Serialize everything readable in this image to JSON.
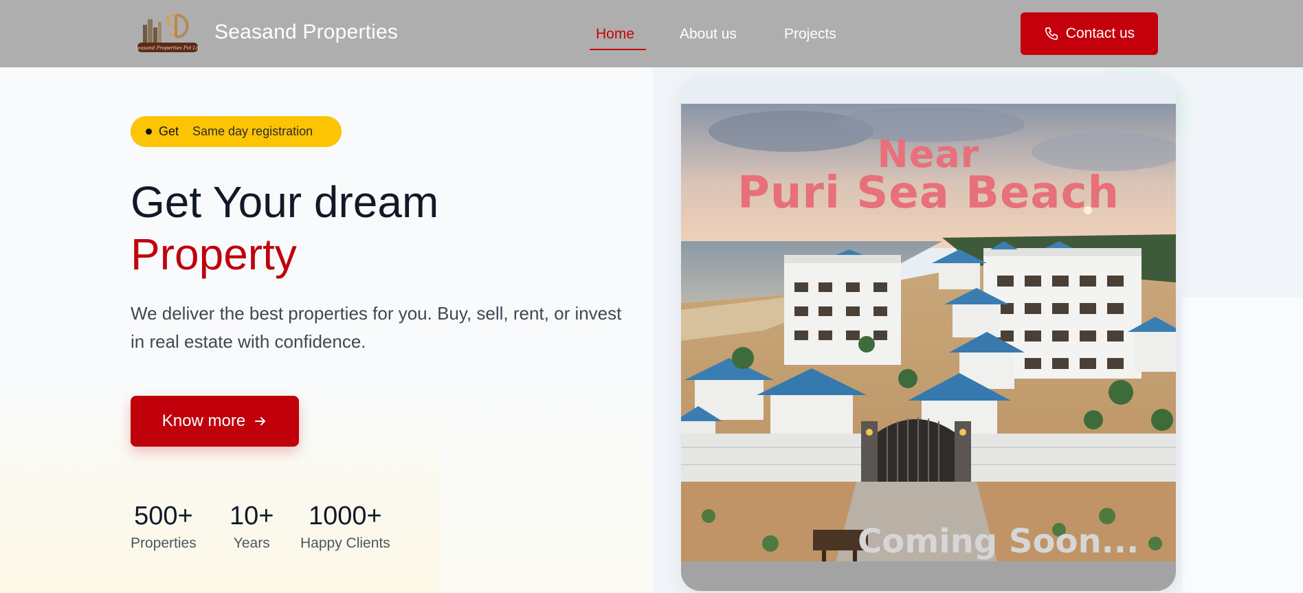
{
  "header": {
    "brand": "Seasand Properties",
    "logo_text": "Seasand Properties Pvt Ltd",
    "nav": [
      {
        "label": "Home",
        "active": true
      },
      {
        "label": "About us",
        "active": false
      },
      {
        "label": "Projects",
        "active": false
      }
    ],
    "contact_label": "Contact us",
    "contact_icon": "phone-icon"
  },
  "hero": {
    "badge_get": "Get",
    "badge_text": "Same day registration",
    "title_line1": "Get Your dream",
    "title_line2": "Property",
    "description": "We deliver the best properties for you. Buy, sell, rent, or invest in real estate with confidence.",
    "cta_label": "Know more",
    "cta_icon": "arrow-right-icon",
    "stats": [
      {
        "value": "500+",
        "label": "Properties"
      },
      {
        "value": "10+",
        "label": "Years"
      },
      {
        "value": "1000+",
        "label": "Happy Clients"
      }
    ]
  },
  "promo": {
    "near": "Near",
    "location": "Puri Sea Beach",
    "coming_soon": "Coming Soon..."
  },
  "colors": {
    "accent": "#c0000b",
    "badge": "#fcc403",
    "header_bg": "#aeaeae",
    "promo_text": "#e8707a"
  }
}
